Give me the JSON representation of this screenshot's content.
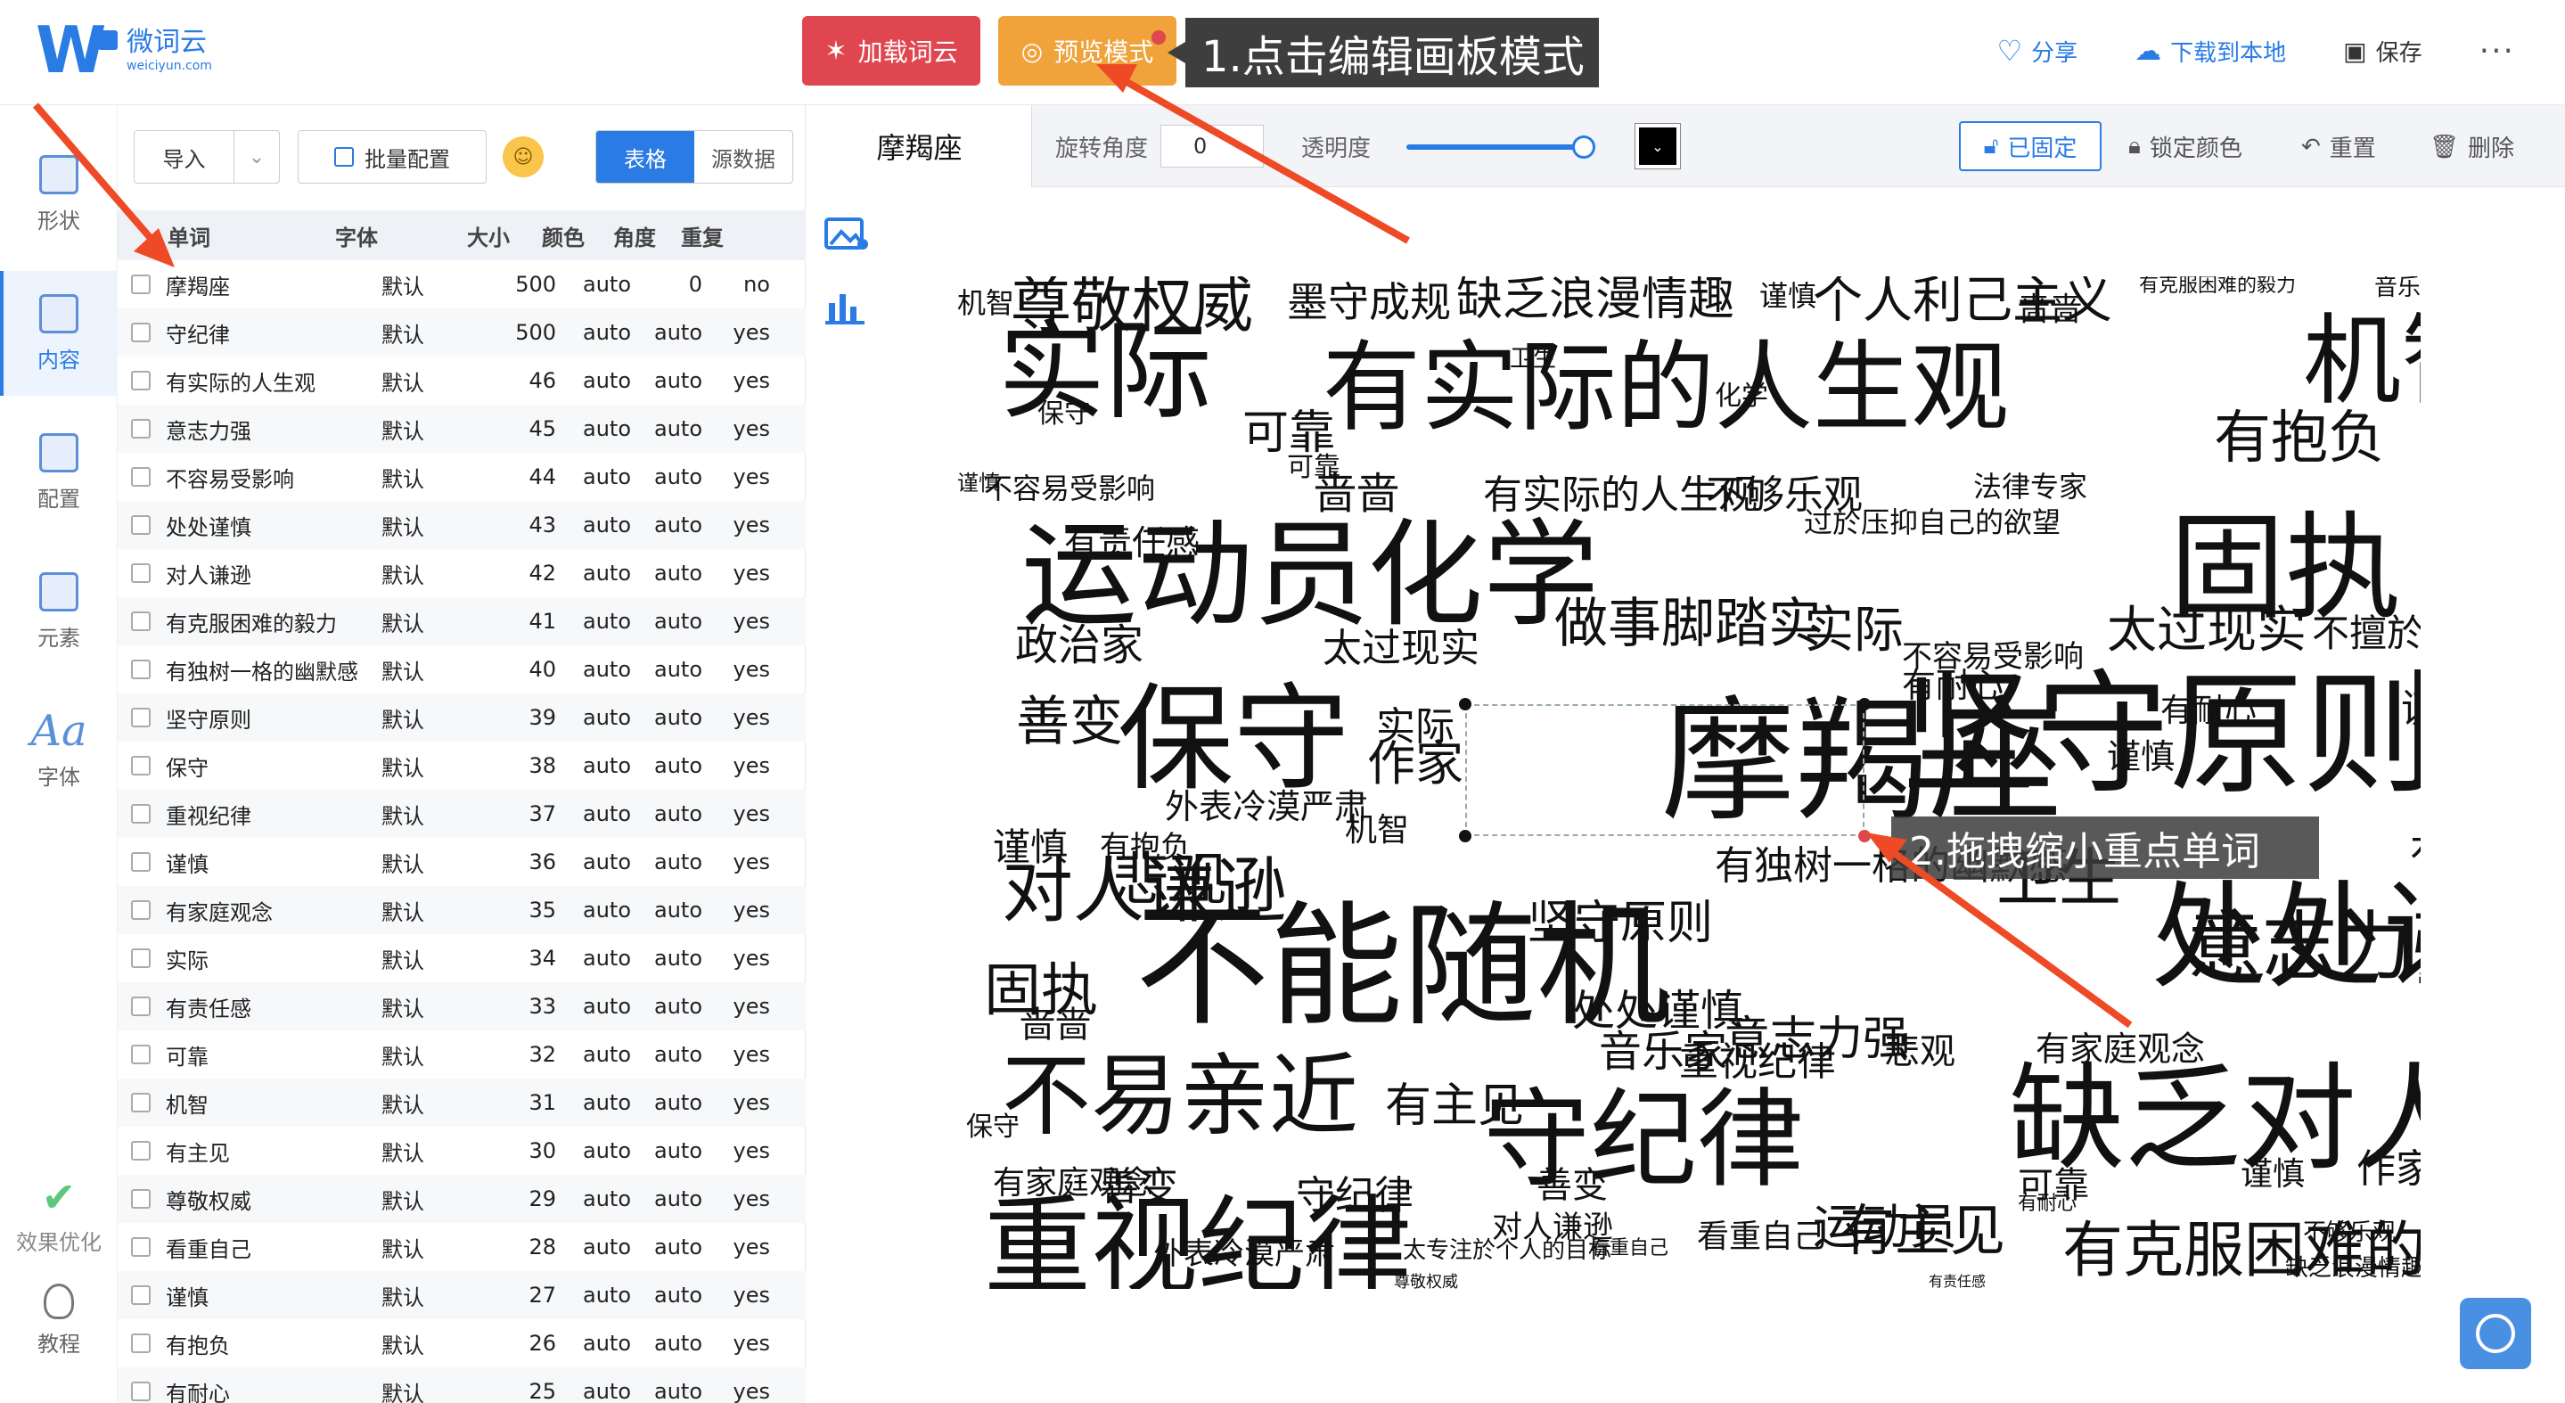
{
  "header": {
    "logo_cn": "微词云",
    "logo_en": "weiciyun.com",
    "load_label": "加载词云",
    "preview_label": "预览模式",
    "tip1": "1.点击编辑画板模式",
    "share": "分享",
    "download": "下载到本地",
    "save": "保存",
    "more": "···"
  },
  "nav": [
    {
      "label": "形状"
    },
    {
      "label": "内容"
    },
    {
      "label": "配置"
    },
    {
      "label": "元素"
    },
    {
      "label": "字体"
    }
  ],
  "nav_extra": {
    "optimize": "效果优化",
    "tutorial": "教程"
  },
  "toolbar": {
    "import": "导入",
    "batch": "批量配置",
    "seg_table": "表格",
    "seg_source": "源数据"
  },
  "table": {
    "headers": {
      "word": "单词",
      "font": "字体",
      "size": "大小",
      "color": "颜色",
      "angle": "角度",
      "repeat": "重复"
    },
    "rows": [
      {
        "word": "摩羯座",
        "font": "默认",
        "size": "500",
        "color": "auto",
        "angle": "0",
        "repeat": "no"
      },
      {
        "word": "守纪律",
        "font": "默认",
        "size": "500",
        "color": "auto",
        "angle": "auto",
        "repeat": "yes"
      },
      {
        "word": "有实际的人生观",
        "font": "默认",
        "size": "46",
        "color": "auto",
        "angle": "auto",
        "repeat": "yes"
      },
      {
        "word": "意志力强",
        "font": "默认",
        "size": "45",
        "color": "auto",
        "angle": "auto",
        "repeat": "yes"
      },
      {
        "word": "不容易受影响",
        "font": "默认",
        "size": "44",
        "color": "auto",
        "angle": "auto",
        "repeat": "yes"
      },
      {
        "word": "处处谨慎",
        "font": "默认",
        "size": "43",
        "color": "auto",
        "angle": "auto",
        "repeat": "yes"
      },
      {
        "word": "对人谦逊",
        "font": "默认",
        "size": "42",
        "color": "auto",
        "angle": "auto",
        "repeat": "yes"
      },
      {
        "word": "有克服困难的毅力",
        "font": "默认",
        "size": "41",
        "color": "auto",
        "angle": "auto",
        "repeat": "yes"
      },
      {
        "word": "有独树一格的幽默感",
        "font": "默认",
        "size": "40",
        "color": "auto",
        "angle": "auto",
        "repeat": "yes"
      },
      {
        "word": "坚守原则",
        "font": "默认",
        "size": "39",
        "color": "auto",
        "angle": "auto",
        "repeat": "yes"
      },
      {
        "word": "保守",
        "font": "默认",
        "size": "38",
        "color": "auto",
        "angle": "auto",
        "repeat": "yes"
      },
      {
        "word": "重视纪律",
        "font": "默认",
        "size": "37",
        "color": "auto",
        "angle": "auto",
        "repeat": "yes"
      },
      {
        "word": "谨慎",
        "font": "默认",
        "size": "36",
        "color": "auto",
        "angle": "auto",
        "repeat": "yes"
      },
      {
        "word": "有家庭观念",
        "font": "默认",
        "size": "35",
        "color": "auto",
        "angle": "auto",
        "repeat": "yes"
      },
      {
        "word": "实际",
        "font": "默认",
        "size": "34",
        "color": "auto",
        "angle": "auto",
        "repeat": "yes"
      },
      {
        "word": "有责任感",
        "font": "默认",
        "size": "33",
        "color": "auto",
        "angle": "auto",
        "repeat": "yes"
      },
      {
        "word": "可靠",
        "font": "默认",
        "size": "32",
        "color": "auto",
        "angle": "auto",
        "repeat": "yes"
      },
      {
        "word": "机智",
        "font": "默认",
        "size": "31",
        "color": "auto",
        "angle": "auto",
        "repeat": "yes"
      },
      {
        "word": "有主见",
        "font": "默认",
        "size": "30",
        "color": "auto",
        "angle": "auto",
        "repeat": "yes"
      },
      {
        "word": "尊敬权威",
        "font": "默认",
        "size": "29",
        "color": "auto",
        "angle": "auto",
        "repeat": "yes"
      },
      {
        "word": "看重自己",
        "font": "默认",
        "size": "28",
        "color": "auto",
        "angle": "auto",
        "repeat": "yes"
      },
      {
        "word": "谨慎",
        "font": "默认",
        "size": "27",
        "color": "auto",
        "angle": "auto",
        "repeat": "yes"
      },
      {
        "word": "有抱负",
        "font": "默认",
        "size": "26",
        "color": "auto",
        "angle": "auto",
        "repeat": "yes"
      },
      {
        "word": "有耐心",
        "font": "默认",
        "size": "25",
        "color": "auto",
        "angle": "auto",
        "repeat": "yes"
      }
    ]
  },
  "editbar": {
    "word_name": "摩羯座",
    "angle_label": "旋转角度",
    "angle_value": "0",
    "opacity_label": "透明度",
    "fixed": "已固定",
    "lock_color": "锁定颜色",
    "reset": "重置",
    "delete": "删除"
  },
  "tip2": "2.拖拽缩小重点单词",
  "cloud_words": [
    "机智",
    "尊敬权威",
    "墨守成规",
    "缺乏浪漫情趣",
    "谨慎",
    "个人利己主义",
    "啬啬",
    "有克服困难的毅力",
    "音乐家",
    "实际",
    "有实际的人生观",
    "机智",
    "可靠",
    "有抱负",
    "卫生",
    "保守",
    "化学",
    "谨慎",
    "不容易受影响",
    "可靠",
    "啬啬",
    "有实际的人生观",
    "不够乐观",
    "法律专家",
    "过於压抑自己的欲望",
    "有责任感",
    "运动员",
    "化学",
    "固执",
    "有耐心",
    "太过现实",
    "不擅於沟通",
    "政治家",
    "太过现实",
    "做事脚踏实",
    "实际",
    "不容易受影响",
    "有耐心",
    "谨慎",
    "善变",
    "保守",
    "实际",
    "作家",
    "摩羯座",
    "坚守原则",
    "谨慎",
    "机智",
    "外表冷漠严肃",
    "卫生",
    "有责任感",
    "谨慎",
    "有抱负",
    "对人谦逊",
    "悲观",
    "有独树一格的幽默感",
    "不能随机",
    "处处谨慎",
    "意志力强",
    "固执",
    "坚守原则",
    "啬啬",
    "处处谨慎",
    "音乐家",
    "重视纪律",
    "意志力强",
    "悲观",
    "有家庭观念",
    "不易亲近",
    "有主见",
    "守纪律",
    "缺乏对人群的关怀和热情",
    "保守",
    "有家庭观念",
    "善变",
    "守纪律",
    "重视纪律",
    "善变",
    "可靠",
    "谨慎",
    "作家",
    "运动员",
    "对人谦逊",
    "有主见",
    "太专注於个人的目标",
    "悲观",
    "看重自己",
    "有克服困难的毅力",
    "保守",
    "外表冷漠严肃",
    "太专注於个人的目标",
    "缺乏浪漫情趣",
    "处处谨慎",
    "尊敬权威",
    "有责任感",
    "有耐心",
    "不够乐观",
    "看重自己"
  ]
}
